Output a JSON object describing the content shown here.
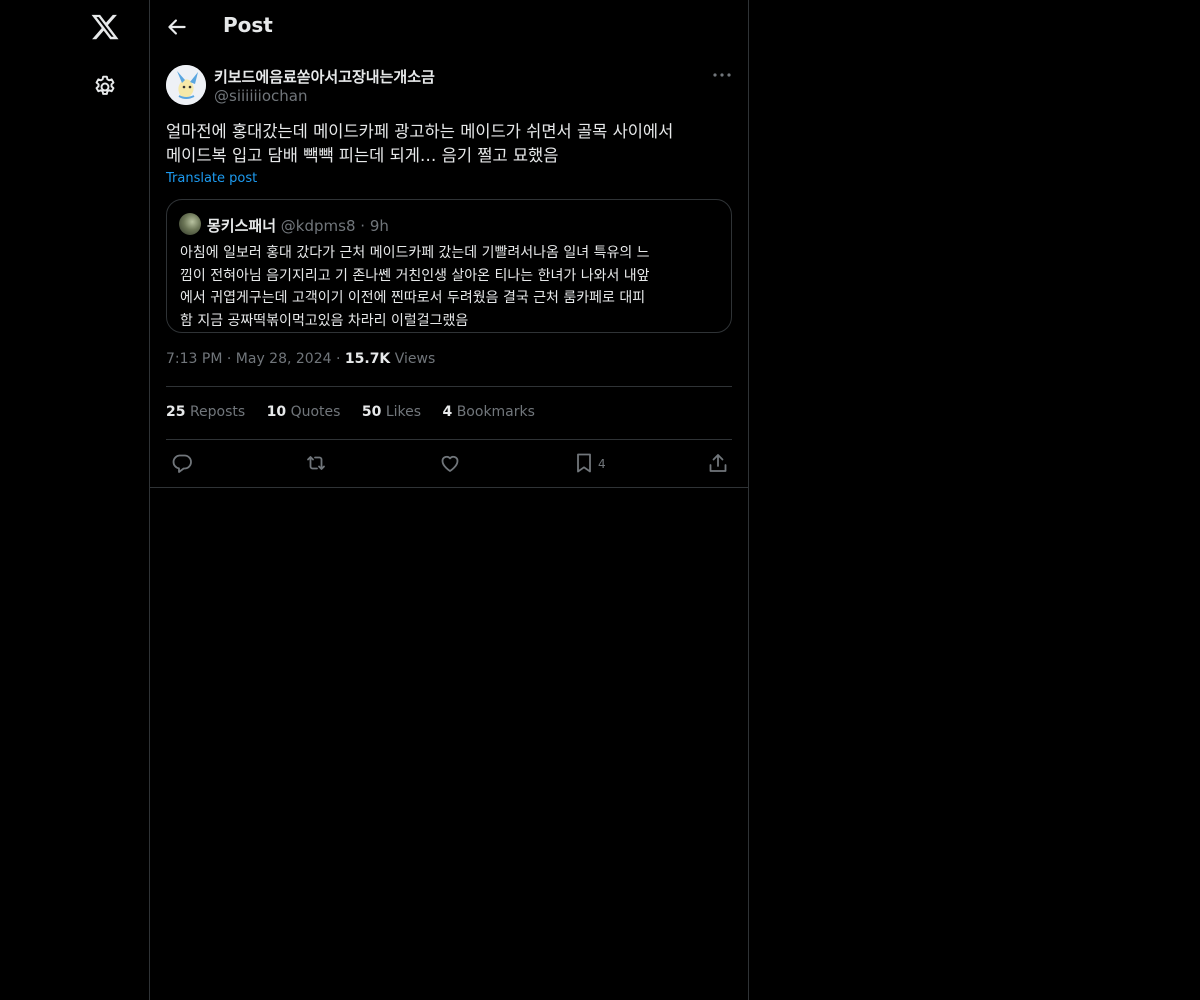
{
  "header": {
    "title": "Post"
  },
  "post": {
    "display_name": "키보드에음료쏟아서고장내는개소금",
    "handle": "@siiiiiiochan",
    "text_lines": [
      "얼마전에 홍대갔는데 메이드카페 광고하는 메이드가 쉬면서 골목 사이에서",
      "메이드복 입고 담배 빽빽 피는데 되게… 음기 쩔고 묘했음"
    ],
    "translate_label": "Translate post",
    "time": "7:13 PM",
    "date": "May 28, 2024",
    "views_count": "15.7K",
    "views_label": "Views"
  },
  "quote": {
    "display_name": "몽키스패너",
    "handle": "@kdpms8",
    "separator": "·",
    "age": "9h",
    "text_lines": [
      "아침에 일보러 홍대 갔다가 근처 메이드카페 갔는데 기빨려서나옴 일녀 특유의 느",
      "낌이 전혀아님 음기지리고 기 존나쎈 거친인생 살아온 티나는 한녀가 나와서 내앞",
      "에서 귀엽게구는데 고객이기 이전에 찐따로서 두려웠음 결국 근처 룸카페로 대피",
      "함 지금 공짜떡볶이먹고있음 차라리 이럴걸그랬음"
    ]
  },
  "stats": {
    "reposts": {
      "count": "25",
      "label": "Reposts"
    },
    "quotes": {
      "count": "10",
      "label": "Quotes"
    },
    "likes": {
      "count": "50",
      "label": "Likes"
    },
    "bookmarks": {
      "count": "4",
      "label": "Bookmarks"
    }
  },
  "actions": {
    "bookmark_count": "4"
  },
  "meta_separator": "·",
  "icons": {
    "nav": [
      "x-logo-icon",
      "gear-icon"
    ],
    "header": [
      "back-arrow-icon"
    ],
    "post": [
      "more-icon"
    ],
    "actions": [
      "reply-icon",
      "repost-icon",
      "like-icon",
      "bookmark-icon",
      "share-icon"
    ]
  },
  "colors": {
    "background": "#000000",
    "text_primary": "#e7e9ea",
    "text_secondary": "#71767b",
    "accent": "#1d9bf0",
    "border": "#2f3336"
  }
}
